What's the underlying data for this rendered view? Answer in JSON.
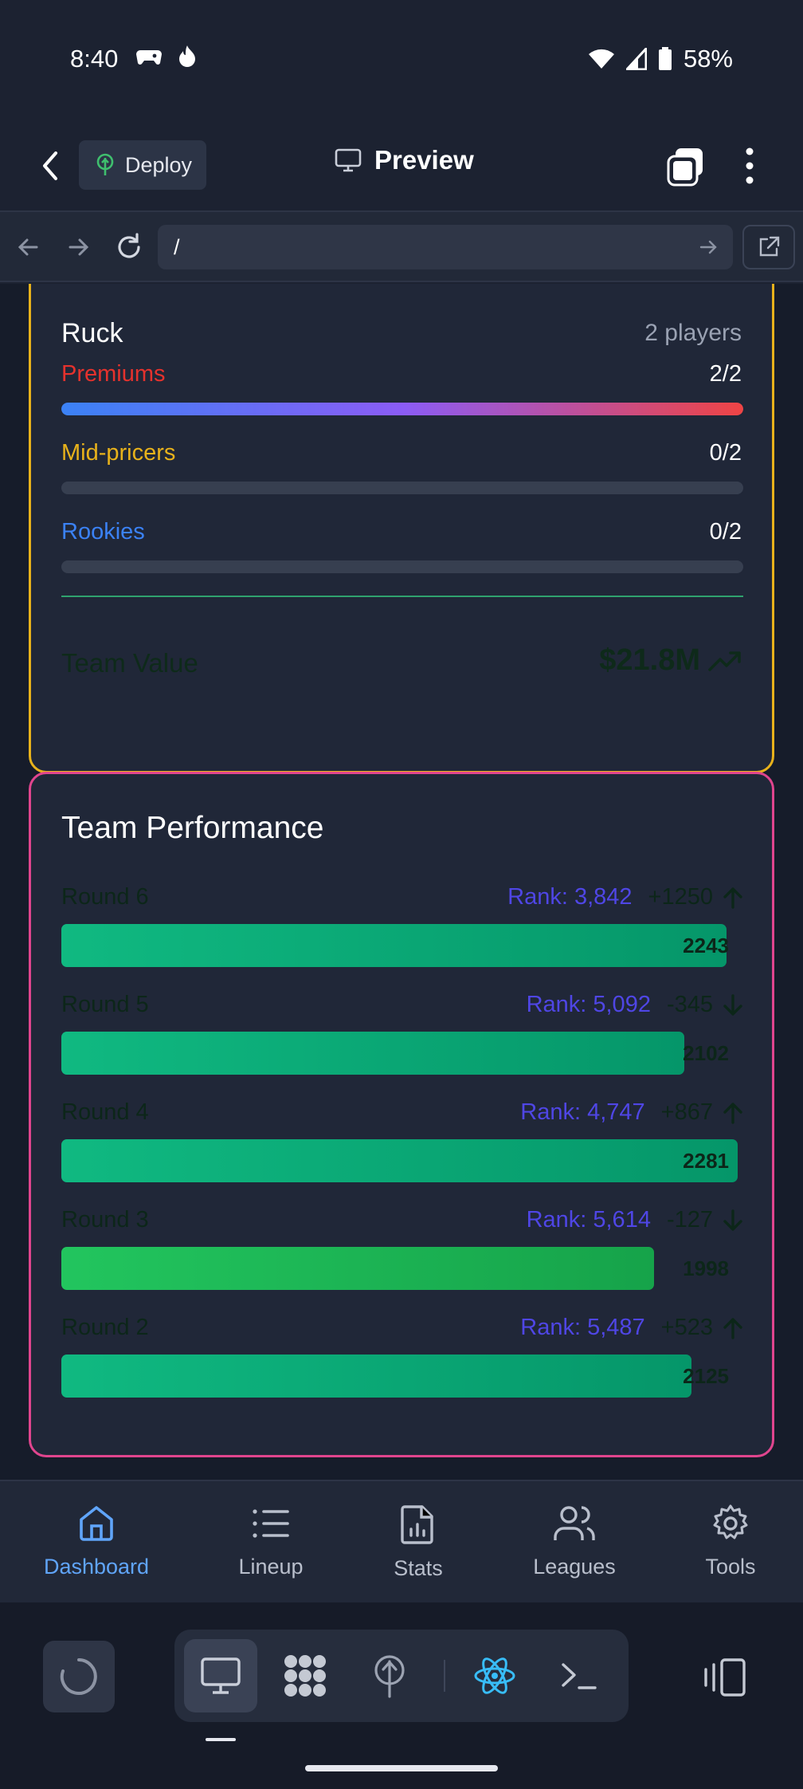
{
  "status_bar": {
    "time": "8:40",
    "battery": "58%"
  },
  "header": {
    "deploy_label": "Deploy",
    "title": "Preview"
  },
  "browser": {
    "url": "/"
  },
  "ruck": {
    "title": "Ruck",
    "count": "2 players",
    "tiers": [
      {
        "label": "Premiums",
        "value": "2/2",
        "fill": 1.0,
        "color": "#e5322d"
      },
      {
        "label": "Mid-pricers",
        "value": "0/2",
        "fill": 0.0,
        "color": "#e8b21b"
      },
      {
        "label": "Rookies",
        "value": "0/2",
        "fill": 0.0,
        "color": "#3b82f6"
      }
    ],
    "team_value_label": "Team Value",
    "team_value": "$21.8M"
  },
  "performance": {
    "title": "Team Performance",
    "max_score": 2300,
    "rounds": [
      {
        "name": "Round 6",
        "rank": "Rank: 3,842",
        "delta": "+1250",
        "direction": "up",
        "score": "2243",
        "score_num": 2243
      },
      {
        "name": "Round 5",
        "rank": "Rank: 5,092",
        "delta": "-345",
        "direction": "down",
        "score": "2102",
        "score_num": 2102
      },
      {
        "name": "Round 4",
        "rank": "Rank: 4,747",
        "delta": "+867",
        "direction": "up",
        "score": "2281",
        "score_num": 2281
      },
      {
        "name": "Round 3",
        "rank": "Rank: 5,614",
        "delta": "-127",
        "direction": "down",
        "score": "1998",
        "score_num": 1998
      },
      {
        "name": "Round 2",
        "rank": "Rank: 5,487",
        "delta": "+523",
        "direction": "up",
        "score": "2125",
        "score_num": 2125
      }
    ]
  },
  "bottom_nav": [
    {
      "label": "Dashboard",
      "icon": "home-icon",
      "active": true
    },
    {
      "label": "Lineup",
      "icon": "list-icon",
      "active": false
    },
    {
      "label": "Stats",
      "icon": "stats-file-icon",
      "active": false
    },
    {
      "label": "Leagues",
      "icon": "users-icon",
      "active": false
    },
    {
      "label": "Tools",
      "icon": "gear-icon",
      "active": false
    }
  ]
}
